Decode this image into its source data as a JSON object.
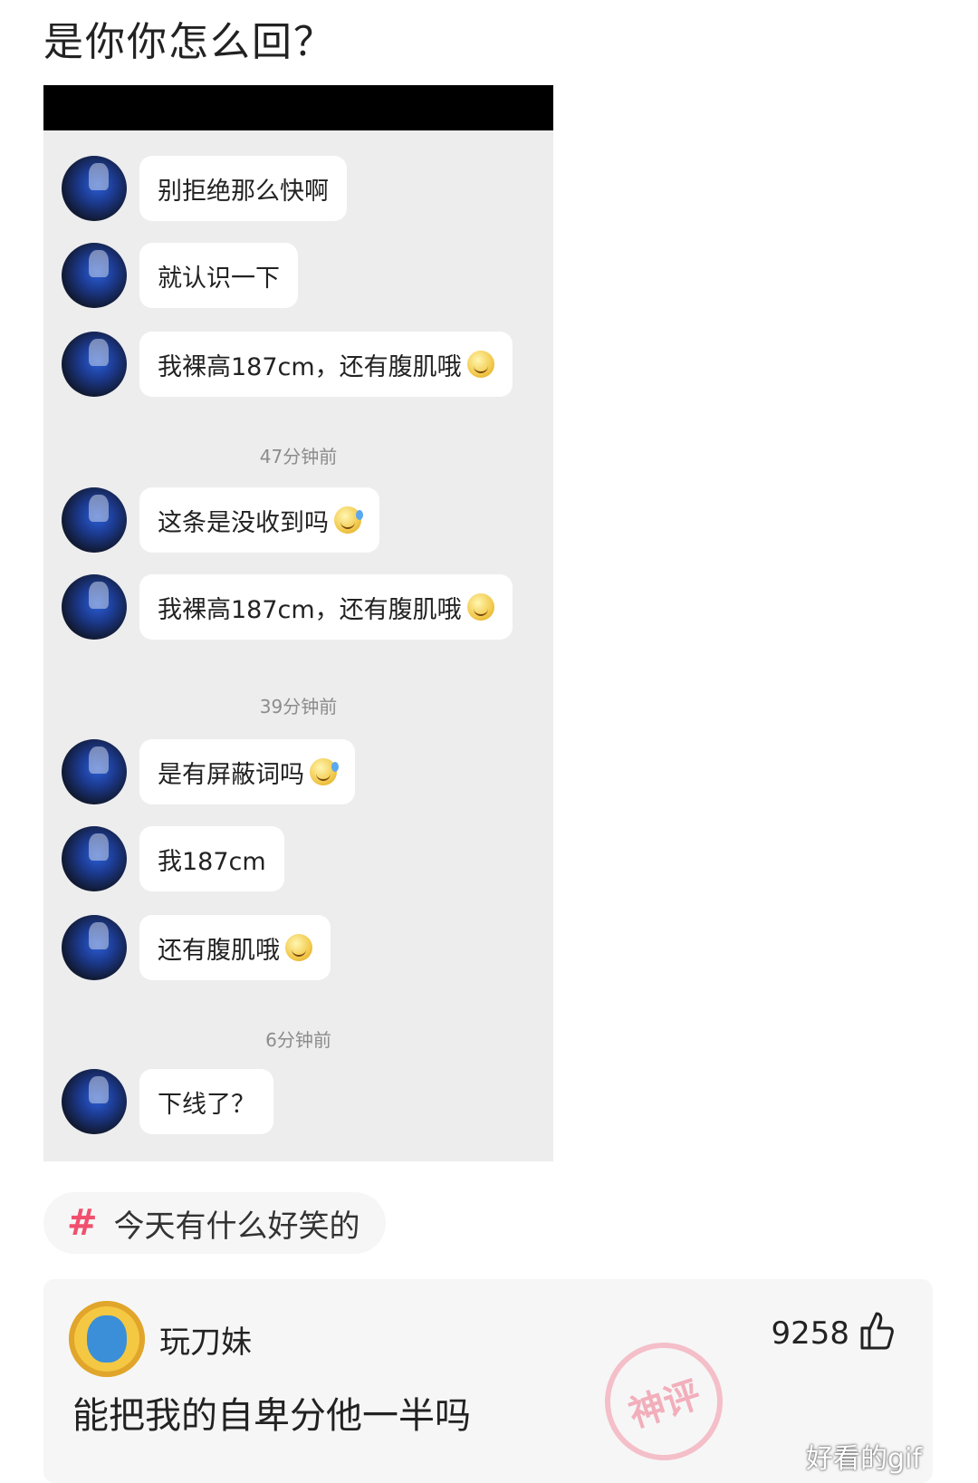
{
  "post": {
    "title": "是你你怎么回？"
  },
  "chat": {
    "messages": [
      {
        "text": "别拒绝那么快啊",
        "emoji": ""
      },
      {
        "text": "就认识一下",
        "emoji": ""
      },
      {
        "text": "我裸高187cm，还有腹肌哦",
        "emoji": "smile-emoji-icon"
      },
      {
        "text": "这条是没收到吗",
        "emoji": "sweat-emoji-icon"
      },
      {
        "text": "我裸高187cm，还有腹肌哦",
        "emoji": "smile-emoji-icon"
      },
      {
        "text": "是有屏蔽词吗",
        "emoji": "sweat-emoji-icon"
      },
      {
        "text": "我187cm",
        "emoji": ""
      },
      {
        "text": "还有腹肌哦",
        "emoji": "smile-emoji-icon"
      },
      {
        "text": "下线了？",
        "emoji": ""
      }
    ],
    "timestamps": [
      "47分钟前",
      "39分钟前",
      "6分钟前"
    ]
  },
  "topic": {
    "hash": "#",
    "label": "今天有什么好笑的"
  },
  "comment": {
    "author": "玩刀妹",
    "likes": "9258",
    "text": "能把我的自卑分他一半吗",
    "badge": "神评"
  },
  "watermark": "好看的gif",
  "colors": {
    "hashtag": "#f0506e",
    "chat_bg": "#ededee",
    "bubble": "#ffffff"
  }
}
